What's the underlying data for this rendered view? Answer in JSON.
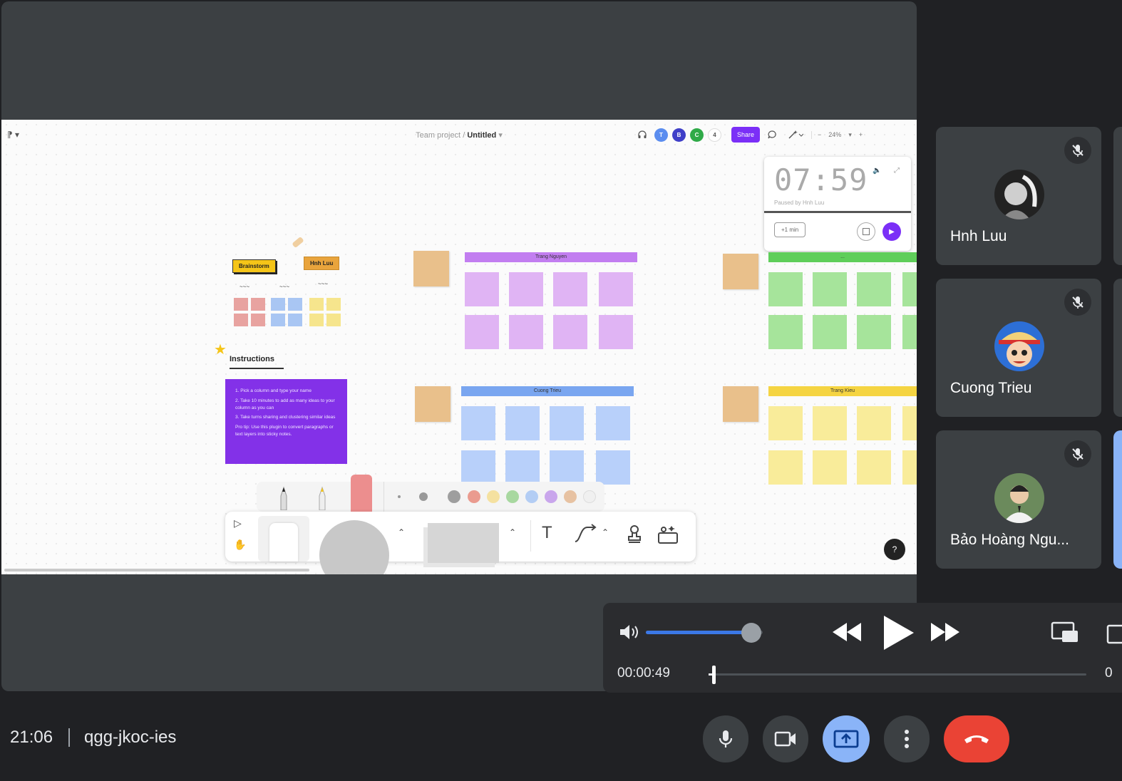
{
  "figjam": {
    "menu_label": "⁋ ▾",
    "project": "Team project",
    "separator": "/",
    "file_name": "Untitled",
    "file_caret": "▾",
    "avatars": [
      {
        "letter": "T",
        "color": "#5b8def"
      },
      {
        "letter": "B",
        "color": "#3f3fc8"
      },
      {
        "letter": "C",
        "color": "#2faa48"
      }
    ],
    "avatar_count": "4",
    "share_label": "Share",
    "zoom": "24%",
    "zoom_minus": "−",
    "zoom_plus": "+"
  },
  "timer": {
    "digits": "07:59",
    "paused_by": "Paused by Hnh Luu",
    "add_label": "+1 min"
  },
  "board": {
    "brainstorm_label": "Brainstorm",
    "hnh_label": "Hnh Luu",
    "instructions_title": "Instructions",
    "instructions": [
      "1. Pick a column and type your name",
      "2. Take 10 minutes to add as many ideas to your column as you can",
      "3. Take turns sharing and clustering similar ideas",
      "Pro tip: Use this plugin to convert paragraphs or text layers into sticky notes."
    ],
    "columns": {
      "purple": "Trang Nguyen",
      "green": "...",
      "blue": "Cuong Trieu",
      "yellow": "Trang Kieu"
    },
    "help_label": "?"
  },
  "participants": [
    {
      "name": "Hnh Luu",
      "muted": true
    },
    {
      "name": "Cuong Trieu",
      "muted": true
    },
    {
      "name": "Bảo Hoàng Ngu...",
      "muted": true
    }
  ],
  "media": {
    "current_time": "00:00:49",
    "end_time_partial": "0",
    "volume_fraction": 0.9,
    "progress_fraction": 0.01
  },
  "meeting": {
    "clock": "21:06",
    "code": "qgg-jkoc-ies"
  },
  "colors": {
    "accent": "#7b2ff7",
    "end_call": "#ea4335",
    "present_active": "#8ab4f8"
  }
}
